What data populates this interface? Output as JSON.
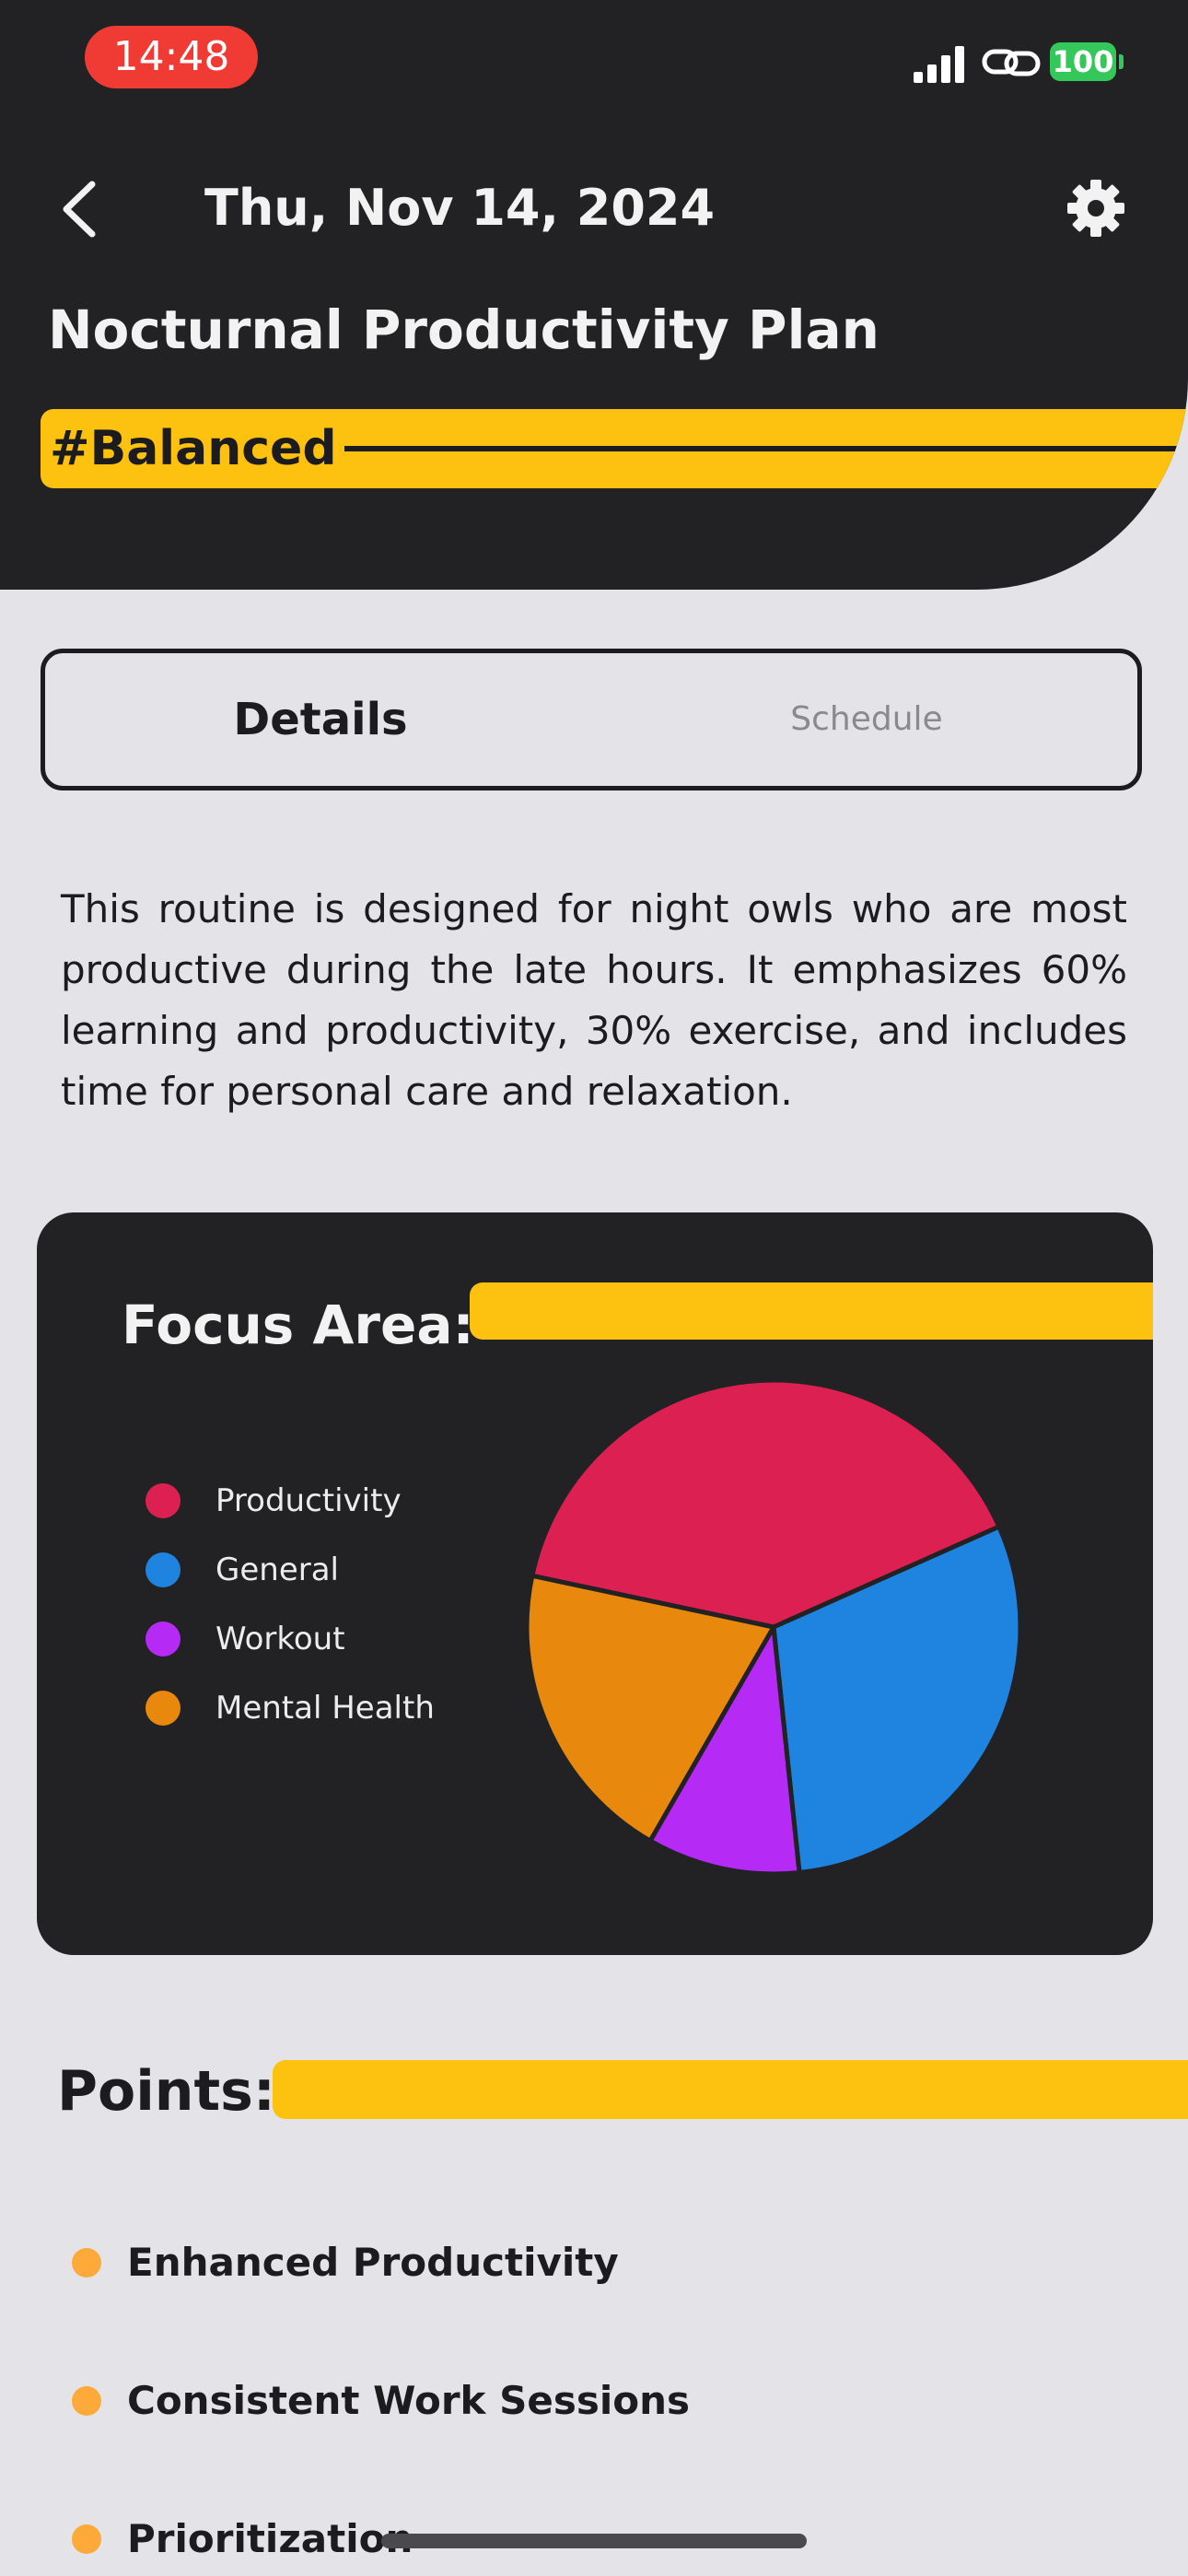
{
  "status_bar": {
    "time": "14:48",
    "battery": "100"
  },
  "header": {
    "date": "Thu, Nov 14, 2024",
    "plan_title": "Nocturnal Productivity Plan",
    "tag": "#Balanced"
  },
  "tabs": [
    {
      "label": "Details",
      "active": true
    },
    {
      "label": "Schedule",
      "active": false
    }
  ],
  "description": "This routine is designed for night owls who are most productive during the late hours. It emphasizes 60% learning and productivity, 30% exercise, and includes time for personal care and relaxation.",
  "focus_area": {
    "title": "Focus Area:",
    "chart_data": {
      "type": "pie",
      "categories": [
        "Productivity",
        "General",
        "Workout",
        "Mental Health"
      ],
      "values": [
        40,
        30,
        10,
        20
      ],
      "colors": [
        "#dd2052",
        "#1f84e0",
        "#b52af5",
        "#e8880c"
      ],
      "legend": "left"
    }
  },
  "points": {
    "title": "Points:",
    "items": [
      "Enhanced Productivity",
      "Consistent Work Sessions",
      "Prioritization"
    ]
  },
  "colors": {
    "accent": "#fdc10f",
    "dark": "#222124",
    "background": "#e4e3e8"
  }
}
